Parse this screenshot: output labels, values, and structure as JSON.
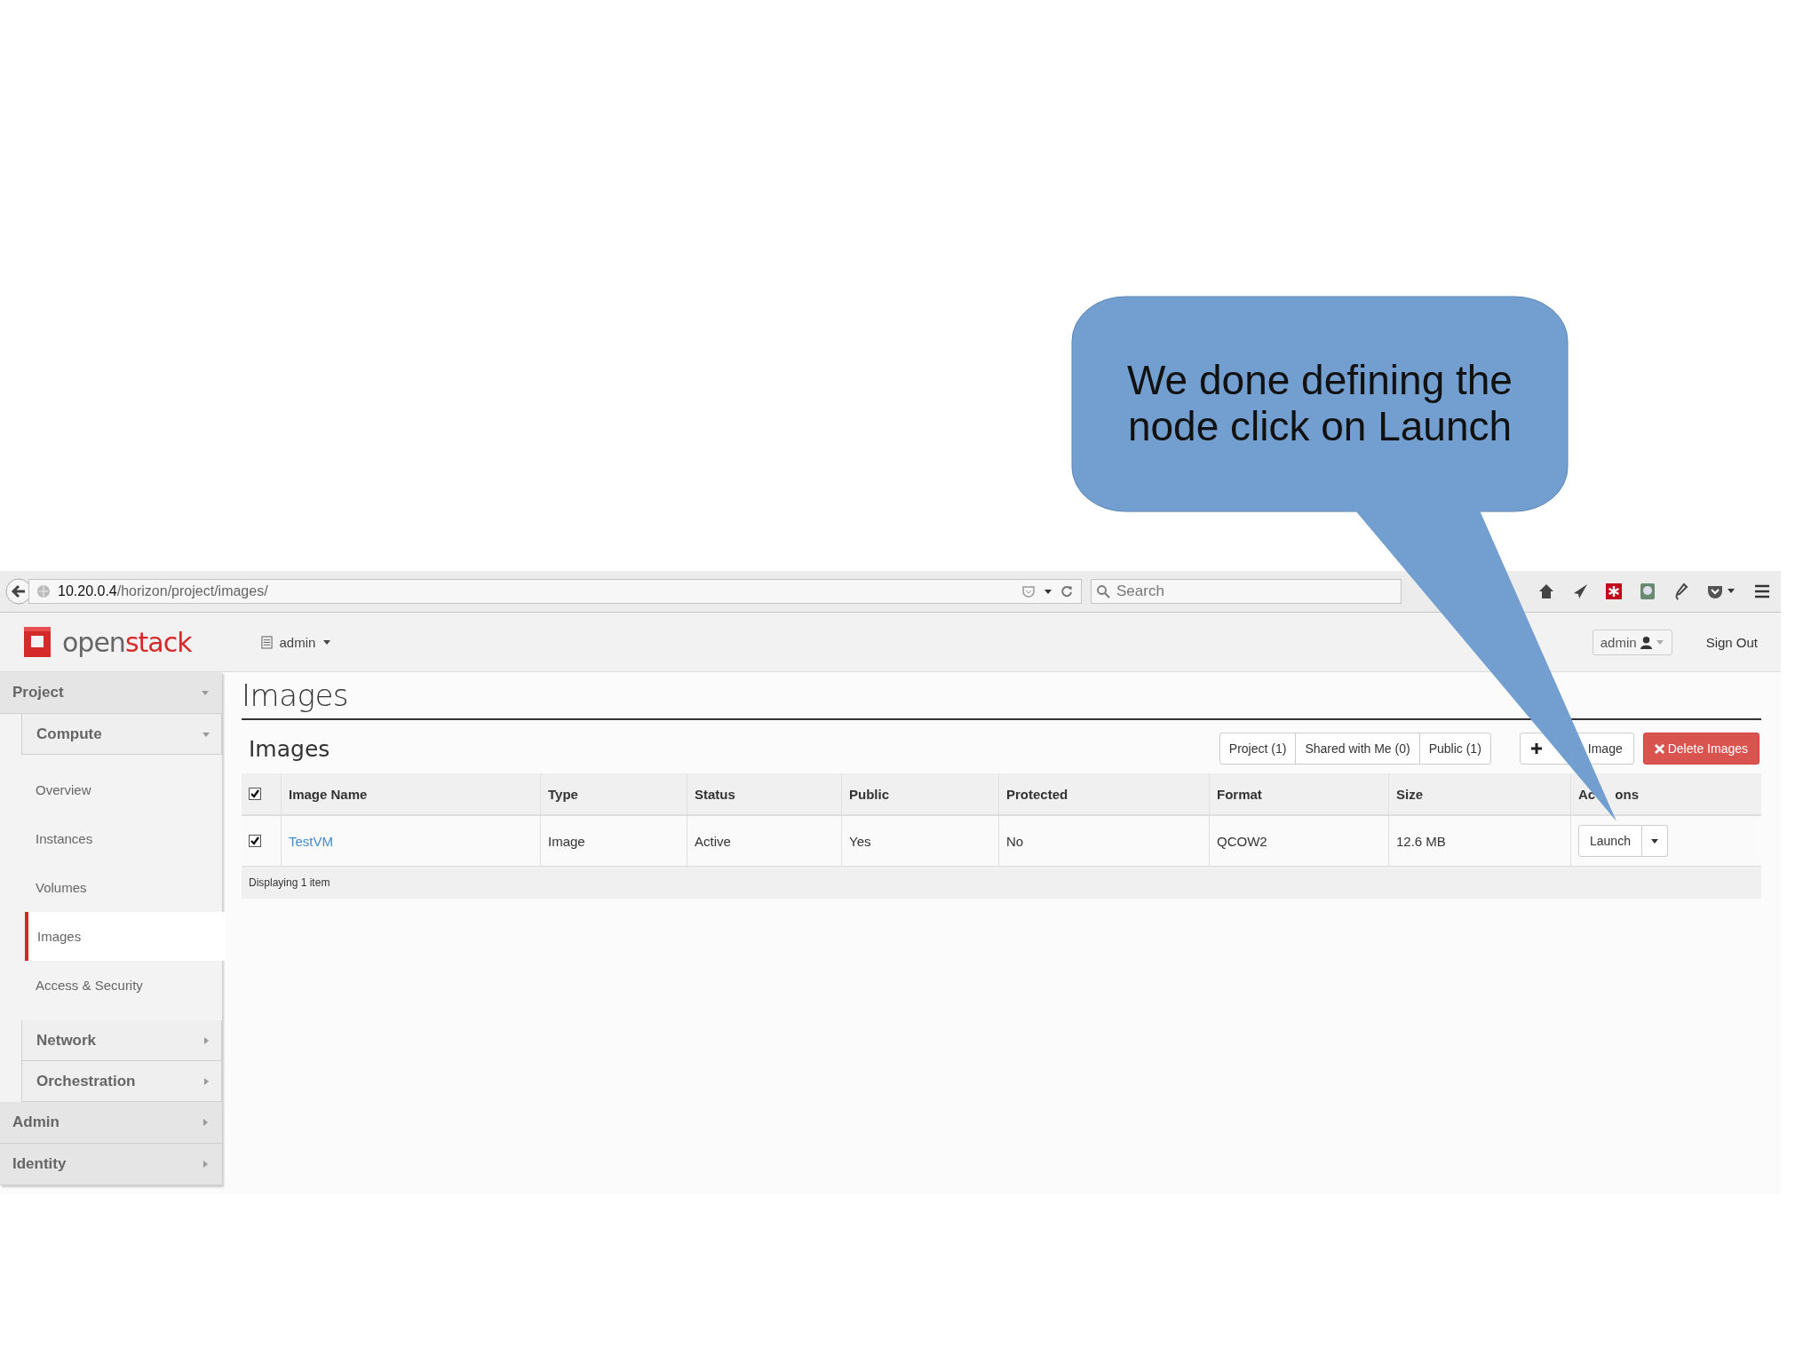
{
  "callout": {
    "text": "We done defining the node click on Launch"
  },
  "browser": {
    "url_host": "10.20.0.4",
    "url_path": "/horizon/project/images/",
    "search": {
      "placeholder": "Search"
    }
  },
  "header": {
    "logo": [
      "open",
      "stack"
    ],
    "project_menu": "admin",
    "user_menu": "admin",
    "sign_out": "Sign Out"
  },
  "sidebar": [
    {
      "label": "Project",
      "expanded": true,
      "children": [
        {
          "label": "Compute",
          "expanded": true,
          "children": [
            {
              "label": "Overview",
              "selected": false
            },
            {
              "label": "Instances",
              "selected": false
            },
            {
              "label": "Volumes",
              "selected": false
            },
            {
              "label": "Images",
              "selected": true
            },
            {
              "label": "Access & Security",
              "selected": false
            }
          ]
        },
        {
          "label": "Network",
          "expanded": false
        },
        {
          "label": "Orchestration",
          "expanded": false
        }
      ]
    },
    {
      "label": "Admin",
      "expanded": false
    },
    {
      "label": "Identity",
      "expanded": false
    }
  ],
  "page_title": "Images",
  "table_title": "Images",
  "filters": [
    "Project (1)",
    "Shared with Me (0)",
    "Public (1)"
  ],
  "buttons": [
    {
      "label": "Image",
      "kind": "add"
    },
    {
      "label": "Delete Images",
      "kind": "delete"
    }
  ],
  "table": {
    "select_all": {
      "checked": true
    },
    "columns": [
      "Image Name",
      "Type",
      "Status",
      "Public",
      "Protected",
      "Format",
      "Size",
      "Ac ons"
    ],
    "rows": [
      {
        "checked": true,
        "cells": [
          "TestVM",
          "Image",
          "Active",
          "Yes",
          "No",
          "QCOW2",
          "12.6 MB"
        ],
        "action": "Launch"
      }
    ],
    "footer": "Displaying 1 item"
  }
}
